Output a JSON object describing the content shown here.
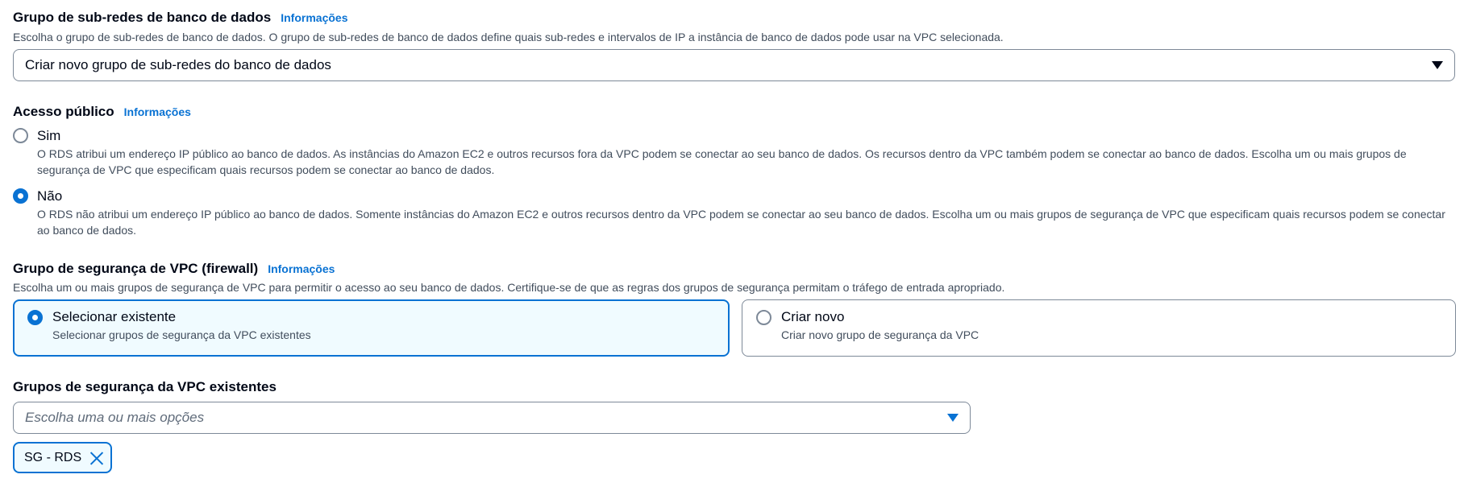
{
  "subnet_group": {
    "title": "Grupo de sub-redes de banco de dados",
    "info": "Informações",
    "description": "Escolha o grupo de sub-redes de banco de dados. O grupo de sub-redes de banco de dados define quais sub-redes e intervalos de IP a instância de banco de dados pode usar na VPC selecionada.",
    "selected_value": "Criar novo grupo de sub-redes do banco de dados"
  },
  "public_access": {
    "title": "Acesso público",
    "info": "Informações",
    "options": [
      {
        "label": "Sim",
        "checked": false,
        "description": "O RDS atribui um endereço IP público ao banco de dados. As instâncias do Amazon EC2 e outros recursos fora da VPC podem se conectar ao seu banco de dados. Os recursos dentro da VPC também podem se conectar ao banco de dados. Escolha um ou mais grupos de segurança de VPC que especificam quais recursos podem se conectar ao banco de dados."
      },
      {
        "label": "Não",
        "checked": true,
        "description": "O RDS não atribui um endereço IP público ao banco de dados. Somente instâncias do Amazon EC2 e outros recursos dentro da VPC podem se conectar ao seu banco de dados. Escolha um ou mais grupos de segurança de VPC que especificam quais recursos podem se conectar ao banco de dados."
      }
    ]
  },
  "security_group": {
    "title": "Grupo de segurança de VPC (firewall)",
    "info": "Informações",
    "description": "Escolha um ou mais grupos de segurança de VPC para permitir o acesso ao seu banco de dados. Certifique-se de que as regras dos grupos de segurança permitam o tráfego de entrada apropriado.",
    "tiles": [
      {
        "title": "Selecionar existente",
        "description": "Selecionar grupos de segurança da VPC existentes",
        "selected": true
      },
      {
        "title": "Criar novo",
        "description": "Criar novo grupo de segurança da VPC",
        "selected": false
      }
    ]
  },
  "existing_groups": {
    "title": "Grupos de segurança da VPC existentes",
    "placeholder": "Escolha uma ou mais opções",
    "tokens": [
      "SG - RDS"
    ]
  },
  "colors": {
    "accent": "#0972d3",
    "text": "#000716",
    "secondary_text": "#414d5c",
    "selected_bg": "#f0fbff"
  }
}
